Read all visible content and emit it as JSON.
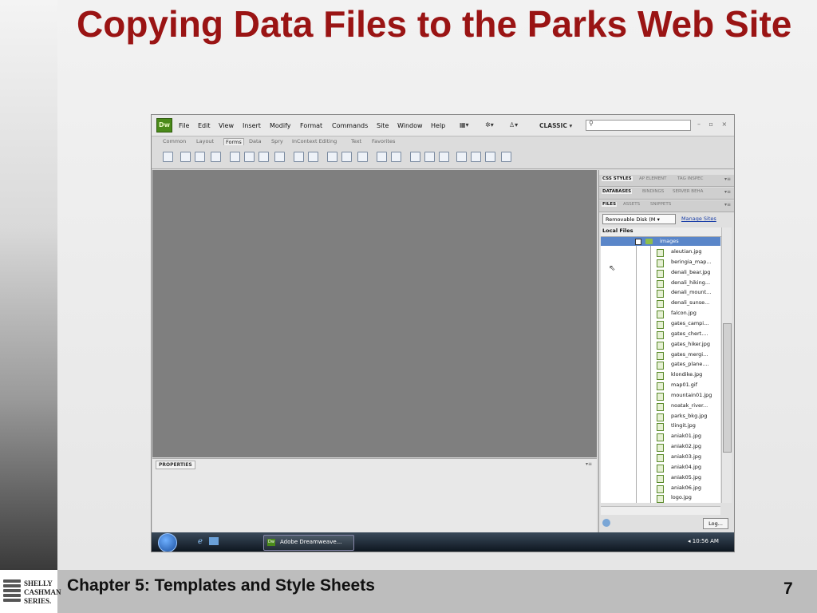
{
  "slide": {
    "title": "Copying Data Files to the Parks Web Site",
    "footer_chapter": "Chapter 5: Templates and Style Sheets",
    "page_number": "7",
    "logo_lines": [
      "SHELLY",
      "CASHMAN",
      "SERIES."
    ]
  },
  "app": {
    "logo": "Dw",
    "menu": [
      "File",
      "Edit",
      "View",
      "Insert",
      "Modify",
      "Format",
      "Commands",
      "Site",
      "Window",
      "Help"
    ],
    "workspace": "CLASSIC ▾",
    "window_controls": "– ▫ ×",
    "insert_tabs": [
      "Common",
      "Layout",
      "Forms",
      "Data",
      "Spry",
      "InContext Editing",
      "Text",
      "Favorites"
    ],
    "active_insert_tab": "Forms"
  },
  "properties_panel": {
    "tab": "PROPERTIES"
  },
  "panels": {
    "group1": [
      "CSS STYLES",
      "AP ELEMENT",
      "TAG INSPEC"
    ],
    "group2": [
      "DATABASES",
      "BINDINGS",
      "SERVER BEHA"
    ],
    "group3": [
      "FILES",
      "ASSETS",
      "SNIPPETS"
    ],
    "disk_select": "Removable Disk (M ▾",
    "manage_sites": "Manage Sites",
    "local_files_header": "Local Files",
    "folder": "images",
    "files": [
      "aleutian.jpg",
      "beringia_map...",
      "denali_bear.jpg",
      "denali_hiking...",
      "denali_mount...",
      "denali_sunse...",
      "falcon.jpg",
      "gates_campi...",
      "gates_chert....",
      "gates_hiker.jpg",
      "gates_mergi...",
      "gates_plane....",
      "klondike.jpg",
      "map01.gif",
      "mountain01.jpg",
      "noatak_river...",
      "parks_bkg.jpg",
      "tlingit.jpg",
      "aniak01.jpg",
      "aniak02.jpg",
      "aniak03.jpg",
      "aniak04.jpg",
      "aniak05.jpg",
      "aniak06.jpg",
      "logo.jpg"
    ],
    "log_button": "Log..."
  },
  "taskbar": {
    "task_label": "Adobe Dreamweave...",
    "clock": "◂ 10:56 AM"
  }
}
